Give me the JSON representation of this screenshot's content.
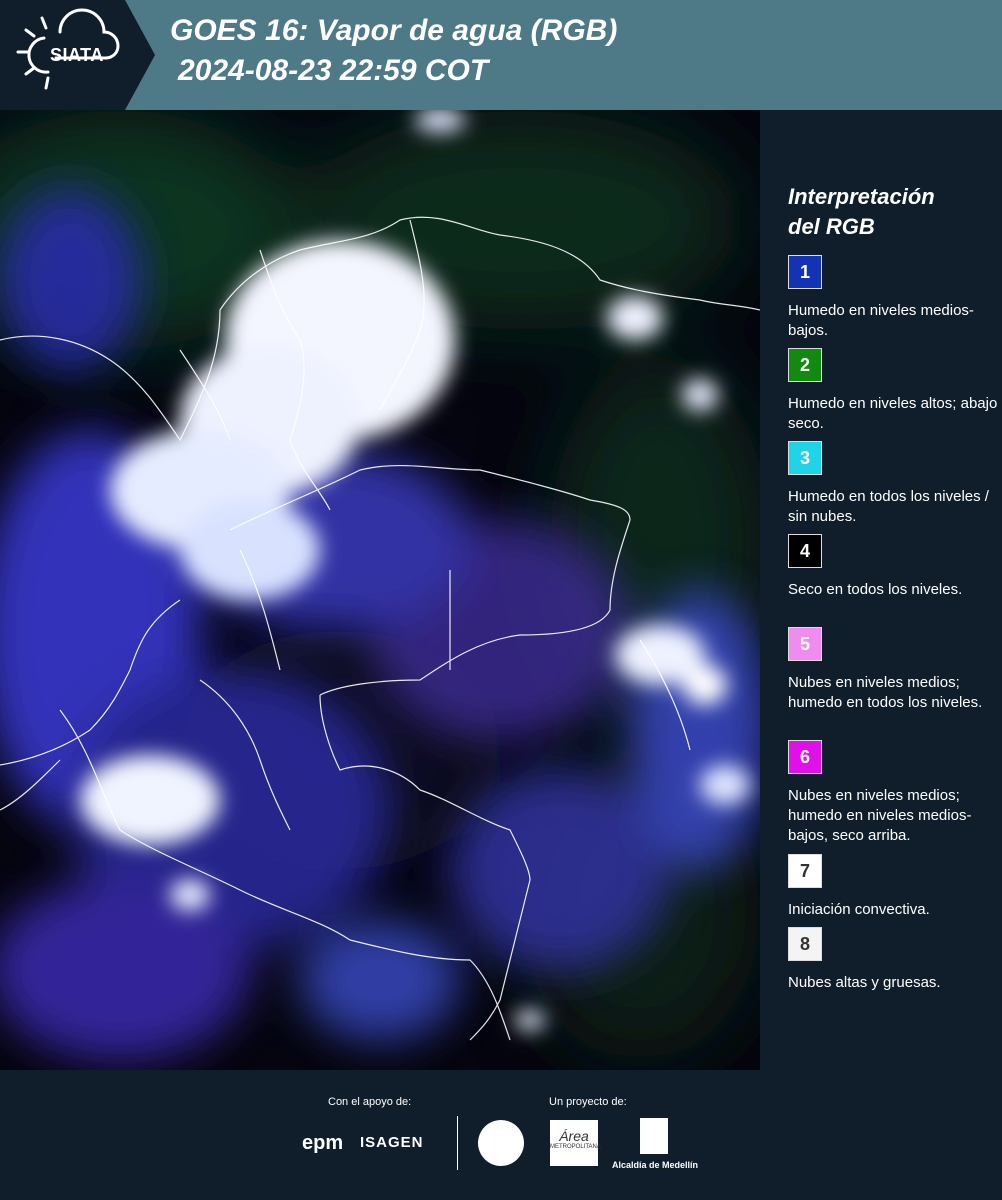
{
  "header": {
    "logo_text": "SIATA",
    "title_line1": "GOES 16: Vapor de agua (RGB)",
    "title_line2": "2024-08-23 22:59 COT"
  },
  "legend": {
    "title_line1": "Interpretación",
    "title_line2": "del RGB",
    "items": [
      {
        "number": "1",
        "color": "#1432b4",
        "num_color": "#ffffff",
        "text": "Humedo en niveles medios-bajos."
      },
      {
        "number": "2",
        "color": "#128a12",
        "num_color": "#ffffff",
        "text": "Humedo en niveles altos; abajo seco."
      },
      {
        "number": "3",
        "color": "#1fd4e8",
        "num_color": "#ffffff",
        "text": "Humedo en todos los niveles / sin nubes."
      },
      {
        "number": "4",
        "color": "#000000",
        "num_color": "#ffffff",
        "text": "Seco en todos los niveles."
      },
      {
        "number": "5",
        "color": "#f08cf0",
        "num_color": "#ffffff",
        "text": "Nubes en niveles medios; humedo en todos los niveles."
      },
      {
        "number": "6",
        "color": "#e010e8",
        "num_color": "#ffffff",
        "text": "Nubes en niveles medios; humedo en niveles medios-bajos, seco arriba."
      },
      {
        "number": "7",
        "color": "#ffffff",
        "num_color": "#333333",
        "text": "Iniciación convectiva."
      },
      {
        "number": "8",
        "color": "#f4f4f4",
        "num_color": "#333333",
        "text": "Nubes altas y gruesas."
      }
    ]
  },
  "footer": {
    "support_label": "Con el apoyo de:",
    "project_label": "Un proyecto de:",
    "epm": "epm",
    "isagen": "ISAGEN",
    "area_text": "METROPOLITANA",
    "alcaldia": "Alcaldía de Medellín"
  }
}
